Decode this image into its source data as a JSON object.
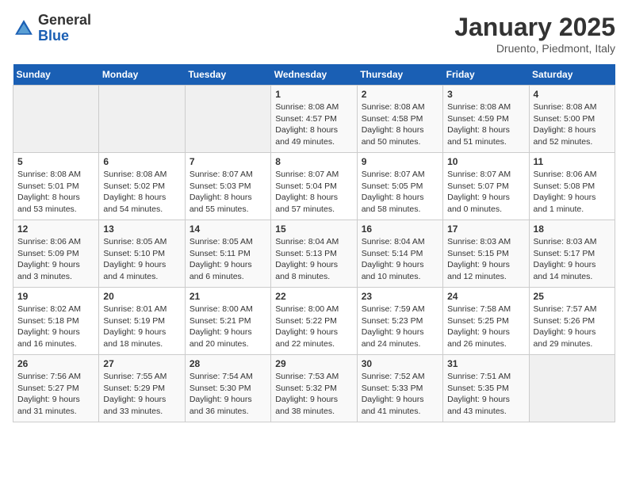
{
  "header": {
    "logo_general": "General",
    "logo_blue": "Blue",
    "month": "January 2025",
    "location": "Druento, Piedmont, Italy"
  },
  "weekdays": [
    "Sunday",
    "Monday",
    "Tuesday",
    "Wednesday",
    "Thursday",
    "Friday",
    "Saturday"
  ],
  "weeks": [
    [
      {
        "day": "",
        "info": ""
      },
      {
        "day": "",
        "info": ""
      },
      {
        "day": "",
        "info": ""
      },
      {
        "day": "1",
        "info": "Sunrise: 8:08 AM\nSunset: 4:57 PM\nDaylight: 8 hours\nand 49 minutes."
      },
      {
        "day": "2",
        "info": "Sunrise: 8:08 AM\nSunset: 4:58 PM\nDaylight: 8 hours\nand 50 minutes."
      },
      {
        "day": "3",
        "info": "Sunrise: 8:08 AM\nSunset: 4:59 PM\nDaylight: 8 hours\nand 51 minutes."
      },
      {
        "day": "4",
        "info": "Sunrise: 8:08 AM\nSunset: 5:00 PM\nDaylight: 8 hours\nand 52 minutes."
      }
    ],
    [
      {
        "day": "5",
        "info": "Sunrise: 8:08 AM\nSunset: 5:01 PM\nDaylight: 8 hours\nand 53 minutes."
      },
      {
        "day": "6",
        "info": "Sunrise: 8:08 AM\nSunset: 5:02 PM\nDaylight: 8 hours\nand 54 minutes."
      },
      {
        "day": "7",
        "info": "Sunrise: 8:07 AM\nSunset: 5:03 PM\nDaylight: 8 hours\nand 55 minutes."
      },
      {
        "day": "8",
        "info": "Sunrise: 8:07 AM\nSunset: 5:04 PM\nDaylight: 8 hours\nand 57 minutes."
      },
      {
        "day": "9",
        "info": "Sunrise: 8:07 AM\nSunset: 5:05 PM\nDaylight: 8 hours\nand 58 minutes."
      },
      {
        "day": "10",
        "info": "Sunrise: 8:07 AM\nSunset: 5:07 PM\nDaylight: 9 hours\nand 0 minutes."
      },
      {
        "day": "11",
        "info": "Sunrise: 8:06 AM\nSunset: 5:08 PM\nDaylight: 9 hours\nand 1 minute."
      }
    ],
    [
      {
        "day": "12",
        "info": "Sunrise: 8:06 AM\nSunset: 5:09 PM\nDaylight: 9 hours\nand 3 minutes."
      },
      {
        "day": "13",
        "info": "Sunrise: 8:05 AM\nSunset: 5:10 PM\nDaylight: 9 hours\nand 4 minutes."
      },
      {
        "day": "14",
        "info": "Sunrise: 8:05 AM\nSunset: 5:11 PM\nDaylight: 9 hours\nand 6 minutes."
      },
      {
        "day": "15",
        "info": "Sunrise: 8:04 AM\nSunset: 5:13 PM\nDaylight: 9 hours\nand 8 minutes."
      },
      {
        "day": "16",
        "info": "Sunrise: 8:04 AM\nSunset: 5:14 PM\nDaylight: 9 hours\nand 10 minutes."
      },
      {
        "day": "17",
        "info": "Sunrise: 8:03 AM\nSunset: 5:15 PM\nDaylight: 9 hours\nand 12 minutes."
      },
      {
        "day": "18",
        "info": "Sunrise: 8:03 AM\nSunset: 5:17 PM\nDaylight: 9 hours\nand 14 minutes."
      }
    ],
    [
      {
        "day": "19",
        "info": "Sunrise: 8:02 AM\nSunset: 5:18 PM\nDaylight: 9 hours\nand 16 minutes."
      },
      {
        "day": "20",
        "info": "Sunrise: 8:01 AM\nSunset: 5:19 PM\nDaylight: 9 hours\nand 18 minutes."
      },
      {
        "day": "21",
        "info": "Sunrise: 8:00 AM\nSunset: 5:21 PM\nDaylight: 9 hours\nand 20 minutes."
      },
      {
        "day": "22",
        "info": "Sunrise: 8:00 AM\nSunset: 5:22 PM\nDaylight: 9 hours\nand 22 minutes."
      },
      {
        "day": "23",
        "info": "Sunrise: 7:59 AM\nSunset: 5:23 PM\nDaylight: 9 hours\nand 24 minutes."
      },
      {
        "day": "24",
        "info": "Sunrise: 7:58 AM\nSunset: 5:25 PM\nDaylight: 9 hours\nand 26 minutes."
      },
      {
        "day": "25",
        "info": "Sunrise: 7:57 AM\nSunset: 5:26 PM\nDaylight: 9 hours\nand 29 minutes."
      }
    ],
    [
      {
        "day": "26",
        "info": "Sunrise: 7:56 AM\nSunset: 5:27 PM\nDaylight: 9 hours\nand 31 minutes."
      },
      {
        "day": "27",
        "info": "Sunrise: 7:55 AM\nSunset: 5:29 PM\nDaylight: 9 hours\nand 33 minutes."
      },
      {
        "day": "28",
        "info": "Sunrise: 7:54 AM\nSunset: 5:30 PM\nDaylight: 9 hours\nand 36 minutes."
      },
      {
        "day": "29",
        "info": "Sunrise: 7:53 AM\nSunset: 5:32 PM\nDaylight: 9 hours\nand 38 minutes."
      },
      {
        "day": "30",
        "info": "Sunrise: 7:52 AM\nSunset: 5:33 PM\nDaylight: 9 hours\nand 41 minutes."
      },
      {
        "day": "31",
        "info": "Sunrise: 7:51 AM\nSunset: 5:35 PM\nDaylight: 9 hours\nand 43 minutes."
      },
      {
        "day": "",
        "info": ""
      }
    ]
  ]
}
